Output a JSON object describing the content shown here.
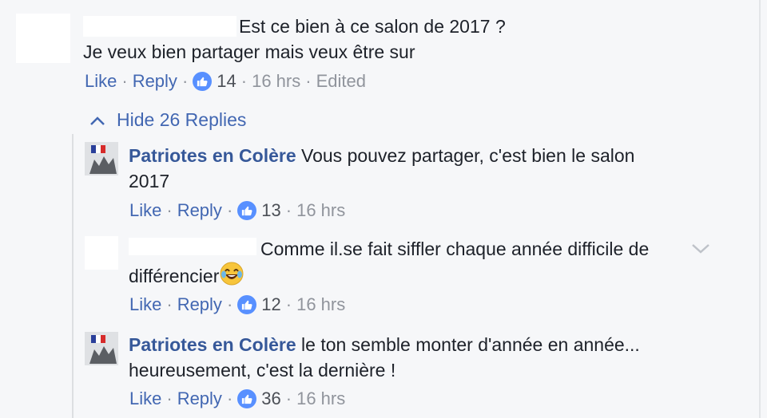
{
  "comments": [
    {
      "text_line1": "Est ce bien à ce salon de 2017 ?",
      "text_line2": "Je veux bien partager mais veux être sur",
      "like_label": "Like",
      "reply_label": "Reply",
      "likes": "14",
      "time": "16 hrs",
      "edited": "Edited"
    }
  ],
  "replies_toggle": {
    "label": "Hide 26 Replies",
    "icon": "chevron-up-icon"
  },
  "replies": [
    {
      "author": "Patriotes en Colère",
      "text_line1": "Vous pouvez partager, c'est bien le salon",
      "text_line2": "2017",
      "like_label": "Like",
      "reply_label": "Reply",
      "likes": "13",
      "time": "16 hrs"
    },
    {
      "text_line1": "Comme il.se fait siffler chaque année difficile de",
      "text_line2": "différencier",
      "emoji": "😂",
      "like_label": "Like",
      "reply_label": "Reply",
      "likes": "12",
      "time": "16 hrs"
    },
    {
      "author": "Patriotes en Colère",
      "text_line1": "le ton semble monter d'année en année...",
      "text_line2": "heureusement, c'est la dernière !",
      "like_label": "Like",
      "reply_label": "Reply",
      "likes": "36",
      "time": "16 hrs"
    }
  ],
  "colors": {
    "background": "#f6f7f9",
    "link": "#4267b2",
    "author": "#365899",
    "meta": "#90949c",
    "like_badge": "#5890ff"
  }
}
